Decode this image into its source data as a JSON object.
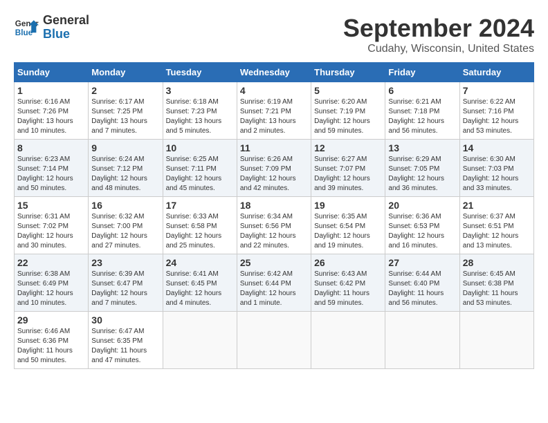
{
  "header": {
    "logo_line1": "General",
    "logo_line2": "Blue",
    "month": "September 2024",
    "location": "Cudahy, Wisconsin, United States"
  },
  "weekdays": [
    "Sunday",
    "Monday",
    "Tuesday",
    "Wednesday",
    "Thursday",
    "Friday",
    "Saturday"
  ],
  "weeks": [
    [
      {
        "day": "1",
        "sunrise": "Sunrise: 6:16 AM",
        "sunset": "Sunset: 7:26 PM",
        "daylight": "Daylight: 13 hours and 10 minutes."
      },
      {
        "day": "2",
        "sunrise": "Sunrise: 6:17 AM",
        "sunset": "Sunset: 7:25 PM",
        "daylight": "Daylight: 13 hours and 7 minutes."
      },
      {
        "day": "3",
        "sunrise": "Sunrise: 6:18 AM",
        "sunset": "Sunset: 7:23 PM",
        "daylight": "Daylight: 13 hours and 5 minutes."
      },
      {
        "day": "4",
        "sunrise": "Sunrise: 6:19 AM",
        "sunset": "Sunset: 7:21 PM",
        "daylight": "Daylight: 13 hours and 2 minutes."
      },
      {
        "day": "5",
        "sunrise": "Sunrise: 6:20 AM",
        "sunset": "Sunset: 7:19 PM",
        "daylight": "Daylight: 12 hours and 59 minutes."
      },
      {
        "day": "6",
        "sunrise": "Sunrise: 6:21 AM",
        "sunset": "Sunset: 7:18 PM",
        "daylight": "Daylight: 12 hours and 56 minutes."
      },
      {
        "day": "7",
        "sunrise": "Sunrise: 6:22 AM",
        "sunset": "Sunset: 7:16 PM",
        "daylight": "Daylight: 12 hours and 53 minutes."
      }
    ],
    [
      {
        "day": "8",
        "sunrise": "Sunrise: 6:23 AM",
        "sunset": "Sunset: 7:14 PM",
        "daylight": "Daylight: 12 hours and 50 minutes."
      },
      {
        "day": "9",
        "sunrise": "Sunrise: 6:24 AM",
        "sunset": "Sunset: 7:12 PM",
        "daylight": "Daylight: 12 hours and 48 minutes."
      },
      {
        "day": "10",
        "sunrise": "Sunrise: 6:25 AM",
        "sunset": "Sunset: 7:11 PM",
        "daylight": "Daylight: 12 hours and 45 minutes."
      },
      {
        "day": "11",
        "sunrise": "Sunrise: 6:26 AM",
        "sunset": "Sunset: 7:09 PM",
        "daylight": "Daylight: 12 hours and 42 minutes."
      },
      {
        "day": "12",
        "sunrise": "Sunrise: 6:27 AM",
        "sunset": "Sunset: 7:07 PM",
        "daylight": "Daylight: 12 hours and 39 minutes."
      },
      {
        "day": "13",
        "sunrise": "Sunrise: 6:29 AM",
        "sunset": "Sunset: 7:05 PM",
        "daylight": "Daylight: 12 hours and 36 minutes."
      },
      {
        "day": "14",
        "sunrise": "Sunrise: 6:30 AM",
        "sunset": "Sunset: 7:03 PM",
        "daylight": "Daylight: 12 hours and 33 minutes."
      }
    ],
    [
      {
        "day": "15",
        "sunrise": "Sunrise: 6:31 AM",
        "sunset": "Sunset: 7:02 PM",
        "daylight": "Daylight: 12 hours and 30 minutes."
      },
      {
        "day": "16",
        "sunrise": "Sunrise: 6:32 AM",
        "sunset": "Sunset: 7:00 PM",
        "daylight": "Daylight: 12 hours and 27 minutes."
      },
      {
        "day": "17",
        "sunrise": "Sunrise: 6:33 AM",
        "sunset": "Sunset: 6:58 PM",
        "daylight": "Daylight: 12 hours and 25 minutes."
      },
      {
        "day": "18",
        "sunrise": "Sunrise: 6:34 AM",
        "sunset": "Sunset: 6:56 PM",
        "daylight": "Daylight: 12 hours and 22 minutes."
      },
      {
        "day": "19",
        "sunrise": "Sunrise: 6:35 AM",
        "sunset": "Sunset: 6:54 PM",
        "daylight": "Daylight: 12 hours and 19 minutes."
      },
      {
        "day": "20",
        "sunrise": "Sunrise: 6:36 AM",
        "sunset": "Sunset: 6:53 PM",
        "daylight": "Daylight: 12 hours and 16 minutes."
      },
      {
        "day": "21",
        "sunrise": "Sunrise: 6:37 AM",
        "sunset": "Sunset: 6:51 PM",
        "daylight": "Daylight: 12 hours and 13 minutes."
      }
    ],
    [
      {
        "day": "22",
        "sunrise": "Sunrise: 6:38 AM",
        "sunset": "Sunset: 6:49 PM",
        "daylight": "Daylight: 12 hours and 10 minutes."
      },
      {
        "day": "23",
        "sunrise": "Sunrise: 6:39 AM",
        "sunset": "Sunset: 6:47 PM",
        "daylight": "Daylight: 12 hours and 7 minutes."
      },
      {
        "day": "24",
        "sunrise": "Sunrise: 6:41 AM",
        "sunset": "Sunset: 6:45 PM",
        "daylight": "Daylight: 12 hours and 4 minutes."
      },
      {
        "day": "25",
        "sunrise": "Sunrise: 6:42 AM",
        "sunset": "Sunset: 6:44 PM",
        "daylight": "Daylight: 12 hours and 1 minute."
      },
      {
        "day": "26",
        "sunrise": "Sunrise: 6:43 AM",
        "sunset": "Sunset: 6:42 PM",
        "daylight": "Daylight: 11 hours and 59 minutes."
      },
      {
        "day": "27",
        "sunrise": "Sunrise: 6:44 AM",
        "sunset": "Sunset: 6:40 PM",
        "daylight": "Daylight: 11 hours and 56 minutes."
      },
      {
        "day": "28",
        "sunrise": "Sunrise: 6:45 AM",
        "sunset": "Sunset: 6:38 PM",
        "daylight": "Daylight: 11 hours and 53 minutes."
      }
    ],
    [
      {
        "day": "29",
        "sunrise": "Sunrise: 6:46 AM",
        "sunset": "Sunset: 6:36 PM",
        "daylight": "Daylight: 11 hours and 50 minutes."
      },
      {
        "day": "30",
        "sunrise": "Sunrise: 6:47 AM",
        "sunset": "Sunset: 6:35 PM",
        "daylight": "Daylight: 11 hours and 47 minutes."
      },
      null,
      null,
      null,
      null,
      null
    ]
  ]
}
